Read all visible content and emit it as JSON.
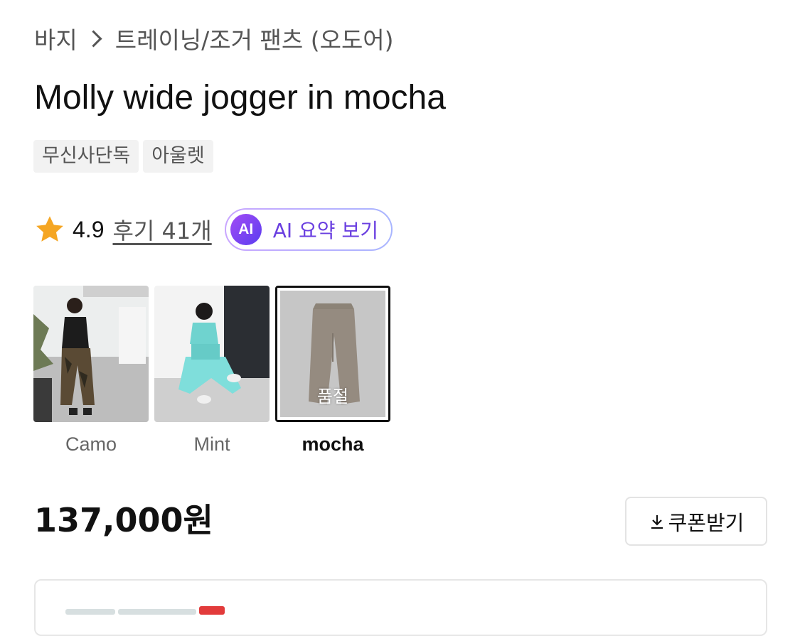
{
  "breadcrumb": {
    "category": "바지",
    "subcategory": "트레이닝/조거 팬츠 (오도어)"
  },
  "product": {
    "title": "Molly wide jogger in mocha",
    "tags": [
      "무신사단독",
      "아울렛"
    ]
  },
  "rating": {
    "value": "4.9",
    "review_label": "후기 41개",
    "ai_badge": "AI",
    "ai_summary_label": "AI 요약 보기"
  },
  "colors": {
    "options": [
      {
        "label": "Camo",
        "selected": false
      },
      {
        "label": "Mint",
        "selected": false
      },
      {
        "label": "mocha",
        "selected": true,
        "status": "품절"
      }
    ]
  },
  "price": {
    "amount": "137,000원",
    "coupon_label": "쿠폰받기"
  },
  "theme": {
    "accent_purple": "#6a3fe0",
    "star_orange": "#f5a623",
    "sale_red": "#e23b3b"
  }
}
